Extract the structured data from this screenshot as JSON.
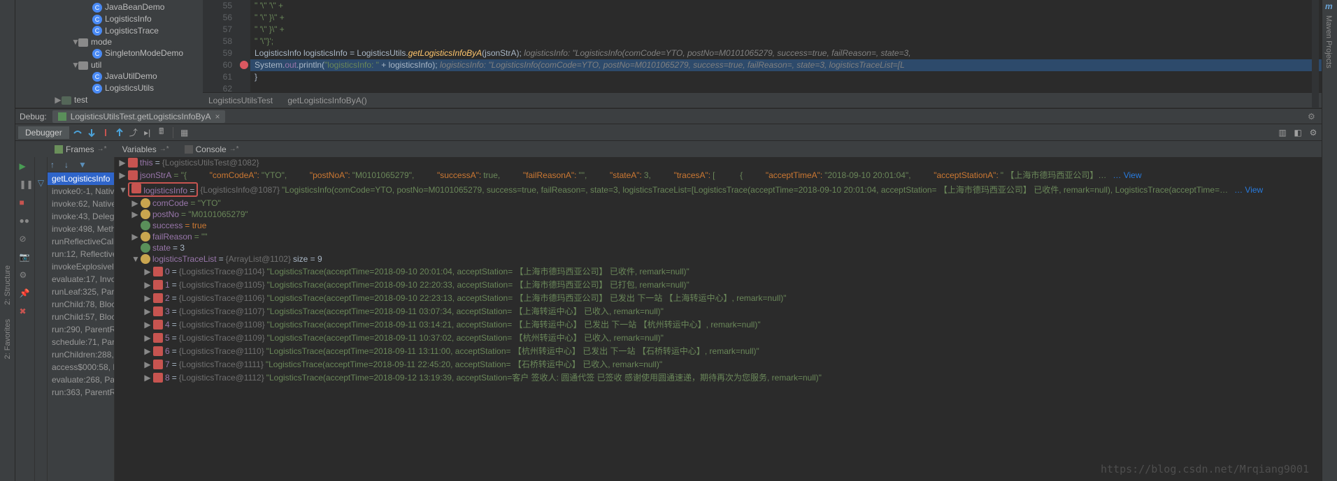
{
  "leftgutter": {
    "structure": "2: Structure",
    "favorites": "2: Favorites"
  },
  "rightgutter": {
    "maven": "Maven Projects",
    "m": "m"
  },
  "projectTree": {
    "items": [
      {
        "indent": 110,
        "kind": "class",
        "label": "JavaBeanDemo"
      },
      {
        "indent": 110,
        "kind": "class",
        "label": "LogisticsInfo"
      },
      {
        "indent": 110,
        "kind": "class",
        "label": "LogisticsTrace"
      },
      {
        "indent": 80,
        "kind": "pkg",
        "arrow": "▼",
        "label": "mode"
      },
      {
        "indent": 110,
        "kind": "class",
        "label": "SingletonModeDemo"
      },
      {
        "indent": 80,
        "kind": "pkg",
        "arrow": "▼",
        "label": "util"
      },
      {
        "indent": 110,
        "kind": "class",
        "label": "JavaUtilDemo"
      },
      {
        "indent": 110,
        "kind": "class",
        "label": "LogisticsUtils"
      },
      {
        "indent": 56,
        "kind": "dir",
        "arrow": "▶",
        "label": "test"
      }
    ]
  },
  "editor": {
    "lines": [
      {
        "n": 55,
        "code": "\"            '\\\"                    '\\\" +"
      },
      {
        "n": 56,
        "code": "\"            '\\\"                }\\\" +"
      },
      {
        "n": 57,
        "code": "\"            '\\\"            }\\\" +"
      },
      {
        "n": 58,
        "code": "\"            '\\\"}';"
      },
      {
        "n": 59,
        "code": "LogisticsInfo logisticsInfo = LogisticsUtils.getLogisticsInfoByA(jsonStrA);",
        "comment": "logisticsInfo: \"LogisticsInfo(comCode=YTO, postNo=M0101065279, success=true, failReason=, state=3,"
      },
      {
        "n": 60,
        "hl": true,
        "bp": true,
        "code": "System.out.println(\"logisticsInfo: \" + logisticsInfo);",
        "comment": "logisticsInfo: \"LogisticsInfo(comCode=YTO, postNo=M0101065279, success=true, failReason=, state=3, logisticsTraceList=[L"
      },
      {
        "n": 61,
        "code": "    }"
      },
      {
        "n": 62,
        "code": ""
      }
    ],
    "crumbs": [
      "LogisticsUtilsTest",
      "getLogisticsInfoByA()"
    ]
  },
  "debug": {
    "label": "Debug:",
    "tab": "LogisticsUtilsTest.getLogisticsInfoByA",
    "debuggerTab": "Debugger",
    "panels": {
      "frames": "Frames",
      "variables": "Variables",
      "console": "Console"
    }
  },
  "frames": {
    "selected": "getLogisticsInfo",
    "list": [
      "getLogisticsInfo",
      "invoke0:-1, Nativ",
      "invoke:62, Native",
      "invoke:43, Deleg",
      "invoke:498, Meth",
      "runReflectiveCall",
      "run:12, Reflective",
      "invokeExplosively",
      "evaluate:17, Invo",
      "runLeaf:325, Pare",
      "runChild:78, Bloc",
      "runChild:57, Bloc",
      "run:290, ParentRu",
      "schedule:71, Pare",
      "runChildren:288,",
      "access$000:58, P",
      "evaluate:268, Par",
      "run:363, ParentRu"
    ]
  },
  "variables": {
    "this": {
      "name": "this",
      "type": "{LogisticsUtilsTest@1082}"
    },
    "jsonStrA": {
      "name": "jsonStrA",
      "eq": "= \"{",
      "pairs": [
        {
          "k": "\"comCodeA\":",
          "v": "\"YTO\","
        },
        {
          "k": "\"postNoA\":",
          "v": "\"M0101065279\","
        },
        {
          "k": "\"successA\":",
          "v": "true,"
        },
        {
          "k": "\"failReasonA\":",
          "v": "\"\","
        },
        {
          "k": "\"stateA\":",
          "v": "3,"
        },
        {
          "k": "\"tracesA\":",
          "v": "["
        },
        {
          "k": "",
          "v": "{"
        },
        {
          "k": "\"acceptTimeA\":",
          "v": "\"2018-09-10 20:01:04\","
        },
        {
          "k": "\"acceptStationA\":",
          "v": "\" 【上海市德玛西亚公司】…"
        }
      ],
      "view": "View"
    },
    "logisticsInfo": {
      "name": "logisticsInfo",
      "eq": "=",
      "type": "{LogisticsInfo@1087}",
      "val": "\"LogisticsInfo(comCode=YTO, postNo=M0101065279, success=true, failReason=, state=3, logisticsTraceList=[LogisticsTrace(acceptTime=2018-09-10 20:01:04, acceptStation= 【上海市德玛西亚公司】 已收件, remark=null), LogisticsTrace(acceptTime=…",
      "view": "View",
      "fields": [
        {
          "ico": "fld",
          "arrow": "▶",
          "name": "comCode",
          "val": "= \"YTO\""
        },
        {
          "ico": "fld",
          "arrow": "▶",
          "name": "postNo",
          "val": "= \"M0101065279\""
        },
        {
          "ico": "prm",
          "arrow": "",
          "name": "success",
          "val": "= true",
          "bool": true
        },
        {
          "ico": "fld",
          "arrow": "▶",
          "name": "failReason",
          "val": "= \"\""
        },
        {
          "ico": "prm",
          "arrow": "",
          "name": "state",
          "val": "= 3",
          "num": true
        }
      ],
      "traceList": {
        "name": "logisticsTraceList",
        "type": "{ArrayList@1102}",
        "size": "size = 9",
        "items": [
          {
            "idx": 0,
            "type": "{LogisticsTrace@1104}",
            "val": "\"LogisticsTrace(acceptTime=2018-09-10 20:01:04, acceptStation= 【上海市德玛西亚公司】 已收件, remark=null)\""
          },
          {
            "idx": 1,
            "type": "{LogisticsTrace@1105}",
            "val": "\"LogisticsTrace(acceptTime=2018-09-10 22:20:33, acceptStation= 【上海市德玛西亚公司】 已打包, remark=null)\""
          },
          {
            "idx": 2,
            "type": "{LogisticsTrace@1106}",
            "val": "\"LogisticsTrace(acceptTime=2018-09-10 22:23:13, acceptStation= 【上海市德玛西亚公司】 已发出 下一站 【上海转运中心】, remark=null)\""
          },
          {
            "idx": 3,
            "type": "{LogisticsTrace@1107}",
            "val": "\"LogisticsTrace(acceptTime=2018-09-11 03:07:34, acceptStation= 【上海转运中心】 已收入, remark=null)\""
          },
          {
            "idx": 4,
            "type": "{LogisticsTrace@1108}",
            "val": "\"LogisticsTrace(acceptTime=2018-09-11 03:14:21, acceptStation= 【上海转运中心】 已发出 下一站 【杭州转运中心】, remark=null)\""
          },
          {
            "idx": 5,
            "type": "{LogisticsTrace@1109}",
            "val": "\"LogisticsTrace(acceptTime=2018-09-11 10:37:02, acceptStation= 【杭州转运中心】 已收入, remark=null)\""
          },
          {
            "idx": 6,
            "type": "{LogisticsTrace@1110}",
            "val": "\"LogisticsTrace(acceptTime=2018-09-11 13:11:00, acceptStation= 【杭州转运中心】 已发出 下一站 【石桥转运中心】, remark=null)\""
          },
          {
            "idx": 7,
            "type": "{LogisticsTrace@1111}",
            "val": "\"LogisticsTrace(acceptTime=2018-09-11 22:45:20, acceptStation= 【石桥转运中心】 已收入, remark=null)\""
          },
          {
            "idx": 8,
            "type": "{LogisticsTrace@1112}",
            "val": "\"LogisticsTrace(acceptTime=2018-09-12 13:19:39, acceptStation=客户 签收人: 圆通代签 已签收 感谢使用圆通速递，期待再次为您服务, remark=null)\""
          }
        ]
      }
    }
  },
  "watermark": "https://blog.csdn.net/Mrqiang9001"
}
